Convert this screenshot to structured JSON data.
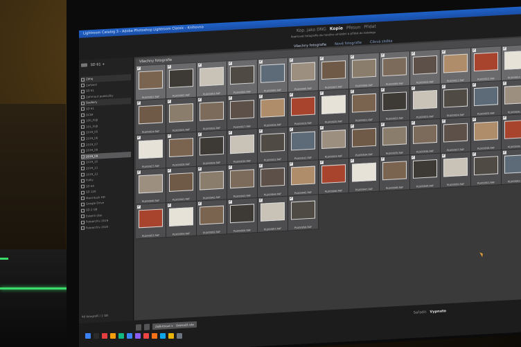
{
  "window_title": "Lightroom Catalog 3 - Adobe Photoshop Lightroom Classic - Knihovna",
  "import_modes": [
    {
      "label": "Kop. jako DNG",
      "active": false
    },
    {
      "label": "Kopie",
      "active": true
    },
    {
      "label": "Přesun",
      "active": false
    },
    {
      "label": "Přidat",
      "active": false
    }
  ],
  "mode_description": "Kopírovat fotografie do nového umístění a přidat do katalogu",
  "view_tabs": [
    {
      "label": "Všechny fotografie",
      "active": true
    },
    {
      "label": "Nové fotografie",
      "active": false
    },
    {
      "label": "Cílová složka",
      "active": false
    }
  ],
  "source": {
    "device": "SD 61 +",
    "tree": [
      {
        "label": "Zdroj",
        "kind": "head"
      },
      {
        "label": "Zařízení",
        "kind": "item"
      },
      {
        "label": "SD 61",
        "kind": "item"
      },
      {
        "label": "Zahrnout podsložky",
        "kind": "item"
      },
      {
        "label": "Soubory",
        "kind": "head"
      },
      {
        "label": "SD 61",
        "kind": "item"
      },
      {
        "label": "DCIM",
        "kind": "item"
      },
      {
        "label": "100_FUJI",
        "kind": "item"
      },
      {
        "label": "101_FUJI",
        "kind": "item"
      },
      {
        "label": "2019_05",
        "kind": "item"
      },
      {
        "label": "2019_06",
        "kind": "item"
      },
      {
        "label": "2019_07",
        "kind": "item"
      },
      {
        "label": "2019_08",
        "kind": "item"
      },
      {
        "label": "2019_09",
        "kind": "sel"
      },
      {
        "label": "2019_10",
        "kind": "item"
      },
      {
        "label": "2019_11",
        "kind": "item"
      },
      {
        "label": "2019_12",
        "kind": "item"
      },
      {
        "label": "Fotky",
        "kind": "item"
      },
      {
        "label": "SD 64",
        "kind": "item"
      },
      {
        "label": "SD 128",
        "kind": "item"
      },
      {
        "label": "Macintosh HD",
        "kind": "item"
      },
      {
        "label": "Google Drive",
        "kind": "item"
      },
      {
        "label": "SD 2 GB",
        "kind": "item"
      },
      {
        "label": "Externí disk",
        "kind": "item"
      },
      {
        "label": "Fotoarchiv 2019",
        "kind": "item"
      },
      {
        "label": "Fotoarchiv 2020",
        "kind": "item"
      }
    ],
    "footer": "48 fotografií / 1 GB"
  },
  "grid_header": "Všechny fotografie",
  "rows": [
    [
      "PLU00001.RAF",
      "PLU00002.RAF",
      "PLU00003.RAF",
      "PLU00004.RAF",
      "PLU00005.RAF",
      "PLU00006.RAF",
      "PLU00007.RAF",
      "PLU00008.RAF",
      "PLU00009.RAF",
      "PLU00010.RAF",
      "PLU00011.RAF",
      "PLU00012.RAF",
      "PLU00013.RAF"
    ],
    [
      "PLU00014.RAF",
      "PLU00015.RAF",
      "PLU00016.RAF",
      "PLU00017.RAF",
      "PLU00018.RAF",
      "PLU00019.RAF",
      "PLU00020.RAF",
      "PLU00021.RAF",
      "PLU00022.RAF",
      "PLU00023.RAF",
      "PLU00024.RAF",
      "PLU00025.RAF",
      "PLU00026.RAF"
    ],
    [
      "PLU00027.RAF",
      "PLU00028.RAF",
      "PLU00029.RAF",
      "PLU00030.RAF",
      "PLU00031.RAF",
      "PLU00032.RAF",
      "PLU00033.RAF",
      "PLU00034.RAF",
      "PLU00035.RAF",
      "PLU00036.RAF",
      "PLU00037.RAF",
      "PLU00038.RAF",
      "PLU00039.RAF"
    ],
    [
      "PLU00040.RAF",
      "PLU00041.RAF",
      "PLU00042.RAF",
      "PLU00043.RAF",
      "PLU00044.RAF",
      "PLU00045.RAF",
      "PLU00046.RAF",
      "PLU00047.RAF",
      "PLU00048.RAF",
      "PLU00049.RAF",
      "PLU00050.RAF",
      "PLU00051.RAF",
      "PLU00052.RAF"
    ],
    [
      "PLU00053.RAF",
      "PLU00054.RAF",
      "PLU00055.RAF",
      "PLU00056.RAF",
      "PLU00057.RAF",
      "PLU00058.RAF"
    ]
  ],
  "thumb_colors": [
    "#7a6450",
    "#5c5048",
    "#9c8f80",
    "#3d3a36",
    "#b08d6a",
    "#6f5a48",
    "#c9c2b6",
    "#a8442e",
    "#8a7d6c",
    "#4f4a44",
    "#e7e2d8",
    "#7c6b5a",
    "#5d6b78"
  ],
  "buttons": {
    "check_all": "Zaškrtnout vše",
    "uncheck_all": "Odznačit vše"
  },
  "sort": {
    "label": "Seřadit:",
    "value": "Vypnuto"
  },
  "accent_color": "#1f62c9"
}
